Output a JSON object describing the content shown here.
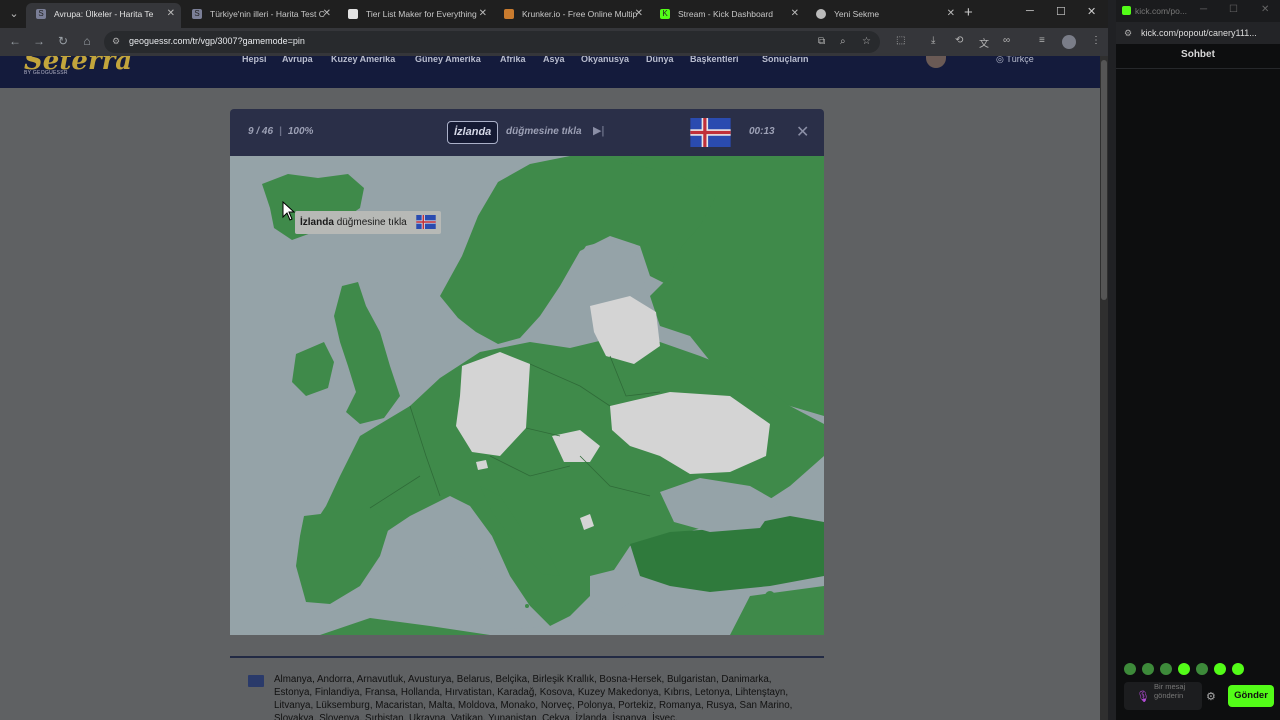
{
  "browser": {
    "tabs": [
      {
        "title": "Avrupa: Ülkeler - Harita Te",
        "active": true,
        "icon": "geoguessr-icon",
        "color": "#7b7f97"
      },
      {
        "title": "Türkiye'nin illeri - Harita Test C",
        "active": false,
        "icon": "geoguessr-icon",
        "color": "#7b7f97"
      },
      {
        "title": "Tier List Maker for Everything",
        "active": false,
        "icon": "tierlist-icon",
        "color": "#e2e2e2"
      },
      {
        "title": "Krunker.io - Free Online Multip",
        "active": false,
        "icon": "krunker-icon",
        "color": "#c97b2e"
      },
      {
        "title": "Stream - Kick Dashboard",
        "active": false,
        "icon": "kick-icon",
        "color": "#53fc18"
      },
      {
        "title": "Yeni Sekme",
        "active": false,
        "icon": "chrome-icon",
        "color": "#bbbbbb"
      }
    ],
    "url": "geoguessr.com/tr/vgp/3007?gamemode=pin"
  },
  "site": {
    "logo": "Seterra",
    "logo_sub": "BY GEOGUESSR",
    "nav": [
      "Hepsi",
      "Avrupa",
      "Kuzey Amerika",
      "Güney Amerika",
      "Afrika",
      "Asya",
      "Okyanusya",
      "Dünya",
      "Başkentleri",
      "Sonuçların"
    ],
    "language": "Türkçe"
  },
  "game": {
    "progress": "9 / 46",
    "accuracy": "100%",
    "target": "İzlanda",
    "instruction": "düğmesine tıkla",
    "timer": "00:13"
  },
  "tooltip": {
    "target": "İzlanda",
    "instruction": "düğmesine tıkla"
  },
  "country_list": "Almanya, Andorra, Arnavutluk, Avusturya, Belarus, Belçika, Birleşik Krallık, Bosna-Hersek, Bulgaristan, Danimarka, Estonya, Finlandiya, Fransa, Hollanda, Hırvatistan, Karadağ, Kosova, Kuzey Makedonya, Kıbrıs, Letonya, Lihtenştayn, Litvanya, Lüksemburg, Macaristan, Malta, Moldova, Monako, Norveç, Polonya, Portekiz, Romanya, Rusya, San Marino, Slovakya, Slovenya, Sırbistan, Ukrayna, Vatikan, Yunanistan, Çekya, İzlanda, İspanya, İsveç,",
  "chat": {
    "tab_title": "kick.com/po...",
    "url": "kick.com/popout/canery111...",
    "title": "Sohbet",
    "placeholder": "Bir mesaj gönderin",
    "send_label": "Gönder"
  },
  "colors": {
    "land_found": "#3f8a4a",
    "land_remaining": "#d4d4d4",
    "sea": "#95a3a8",
    "kick_green": "#53fc18"
  }
}
